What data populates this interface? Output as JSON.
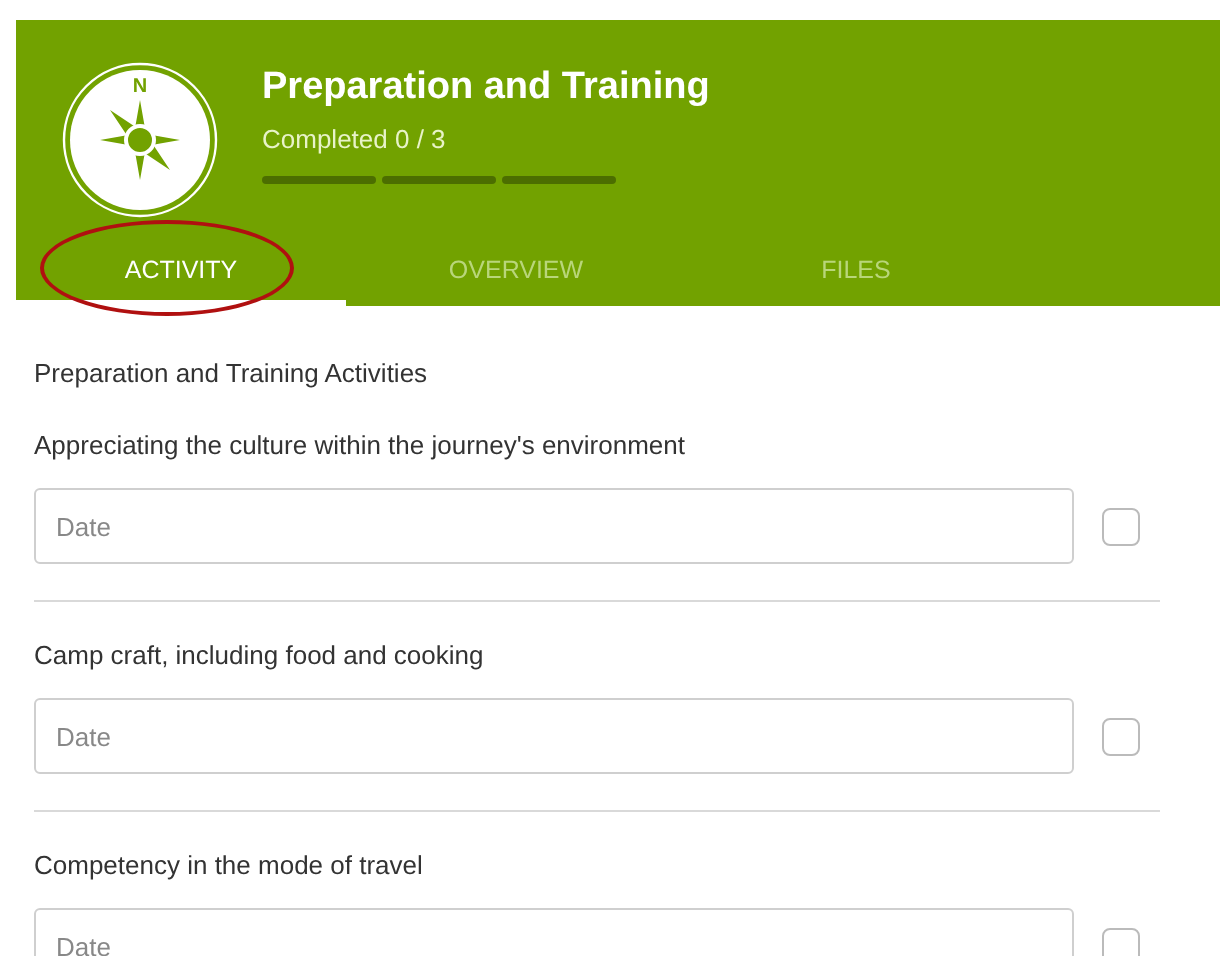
{
  "header": {
    "compass_letter": "N",
    "title": "Preparation and Training",
    "subtitle": "Completed 0 / 3",
    "progress": [
      {
        "done": false
      },
      {
        "done": false
      },
      {
        "done": false
      }
    ]
  },
  "tabs": [
    {
      "label": "ACTIVITY",
      "selected": true
    },
    {
      "label": "OVERVIEW",
      "selected": false
    },
    {
      "label": "FILES",
      "selected": false
    }
  ],
  "section_title": "Preparation and Training Activities",
  "activities": [
    {
      "label": "Appreciating the culture within the journey's environment",
      "placeholder": "Date",
      "checked": false
    },
    {
      "label": "Camp craft, including food and cooking",
      "placeholder": "Date",
      "checked": false
    },
    {
      "label": "Competency in the mode of travel",
      "placeholder": "Date",
      "checked": false
    }
  ]
}
